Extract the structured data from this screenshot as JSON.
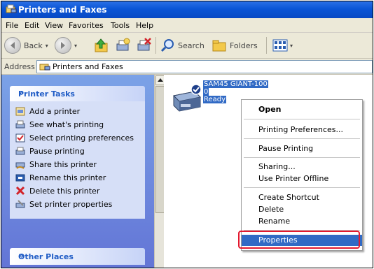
{
  "window": {
    "title": "Printers and Faxes"
  },
  "menu": [
    "File",
    "Edit",
    "View",
    "Favorites",
    "Tools",
    "Help"
  ],
  "toolbar": {
    "back_label": "Back",
    "search_label": "Search",
    "folders_label": "Folders"
  },
  "address": {
    "label": "Address",
    "value": "Printers and Faxes"
  },
  "tasks": {
    "header": "Printer Tasks",
    "items": [
      {
        "label": "Add a printer",
        "icon": "add-printer-icon"
      },
      {
        "label": "See what's printing",
        "icon": "print-queue-icon"
      },
      {
        "label": "Select printing preferences",
        "icon": "preferences-icon"
      },
      {
        "label": "Pause printing",
        "icon": "pause-icon"
      },
      {
        "label": "Share this printer",
        "icon": "share-icon"
      },
      {
        "label": "Rename this printer",
        "icon": "rename-icon"
      },
      {
        "label": "Delete this printer",
        "icon": "delete-icon"
      },
      {
        "label": "Set printer properties",
        "icon": "properties-icon"
      }
    ]
  },
  "other": {
    "header": "Other Places"
  },
  "printer": {
    "name_line1": "SAM45 GIANT-100",
    "name_line2": "0",
    "status": "Ready"
  },
  "context_menu": {
    "open": "Open",
    "printing_preferences": "Printing Preferences...",
    "pause_printing": "Pause Printing",
    "sharing": "Sharing...",
    "use_offline": "Use Printer Offline",
    "create_shortcut": "Create Shortcut",
    "delete": "Delete",
    "rename": "Rename",
    "properties": "Properties"
  },
  "colors": {
    "title_bar": "#0a55d6",
    "selection": "#316ac5",
    "highlight_box": "#e3192f",
    "task_pane": "#6375d6"
  }
}
